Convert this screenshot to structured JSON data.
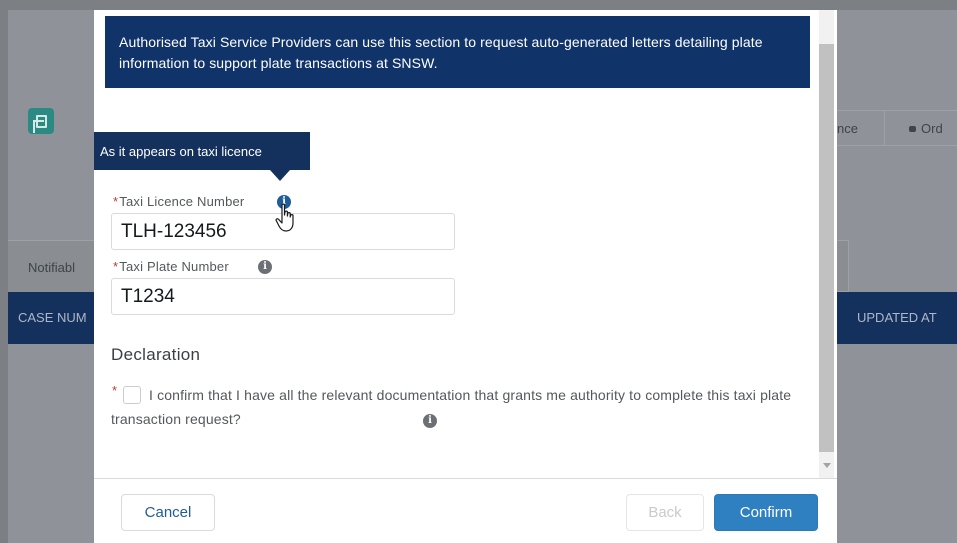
{
  "background": {
    "tab_partial_left": "Notifiabl",
    "tab_right_1": "nce",
    "tab_right_2": "Ord",
    "table_header_left": "CASE NUM",
    "table_header_right": "UPDATED AT"
  },
  "modal": {
    "banner_text": "Authorised Taxi Service Providers can use this section to request auto-generated letters detailing plate information to support plate transactions at SNSW.",
    "tooltip_text": "As it appears on taxi licence",
    "fields": {
      "licence": {
        "label": "Taxi Licence Number",
        "value": "TLH-123456",
        "required_mark": "*"
      },
      "plate": {
        "label": "Taxi Plate Number",
        "value": "T1234",
        "required_mark": "*"
      }
    },
    "declaration": {
      "title": "Declaration",
      "required_mark": "*",
      "text": "I confirm that I have all the relevant documentation that grants me authority to complete this taxi plate transaction request?",
      "checked": false
    },
    "info_icon_glyph": "i",
    "buttons": {
      "cancel": "Cancel",
      "back": "Back",
      "confirm": "Confirm"
    }
  },
  "colors": {
    "banner_bg": "#10336a",
    "primary_button": "#2f80c0",
    "required": "#c23934",
    "table_header": "#14315e"
  },
  "icons": {
    "app_icon": "document-icon",
    "info": "info-icon",
    "pointer": "hand-cursor-icon"
  }
}
